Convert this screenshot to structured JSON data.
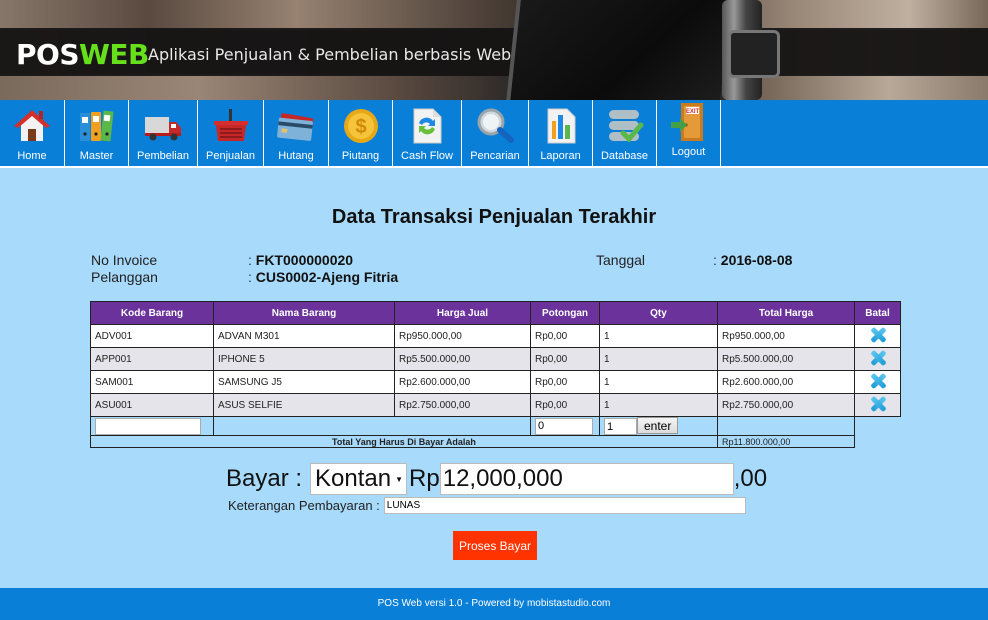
{
  "header": {
    "logo_pos": "POS",
    "logo_web": "WEB",
    "tagline": "Aplikasi Penjualan & Pembelian berbasis Web"
  },
  "nav": {
    "items": [
      {
        "label": "Home",
        "icon": "home-icon"
      },
      {
        "label": "Master",
        "icon": "binders-icon"
      },
      {
        "label": "Pembelian",
        "icon": "truck-icon"
      },
      {
        "label": "Penjualan",
        "icon": "basket-icon"
      },
      {
        "label": "Hutang",
        "icon": "credit-card-icon"
      },
      {
        "label": "Piutang",
        "icon": "coin-icon"
      },
      {
        "label": "Cash Flow",
        "icon": "exchange-document-icon"
      },
      {
        "label": "Pencarian",
        "icon": "magnifier-icon"
      },
      {
        "label": "Laporan",
        "icon": "report-chart-icon"
      },
      {
        "label": "Database",
        "icon": "database-check-icon"
      },
      {
        "label": "Logout",
        "icon": "exit-door-icon"
      }
    ]
  },
  "page": {
    "title": "Data Transaksi Penjualan Terakhir",
    "invoice_label": "No Invoice",
    "invoice_value": "FKT000000020",
    "customer_label": "Pelanggan",
    "customer_value": "CUS0002-Ajeng Fitria",
    "date_label": "Tanggal",
    "date_value": "2016-08-08",
    "colon": ":"
  },
  "table": {
    "headers": [
      "Kode Barang",
      "Nama Barang",
      "Harga Jual",
      "Potongan",
      "Qty",
      "Total Harga",
      "Batal"
    ],
    "rows": [
      {
        "kode": "ADV001",
        "nama": "ADVAN M301",
        "harga": "Rp950.000,00",
        "potongan": "Rp0,00",
        "qty": "1",
        "total": "Rp950.000,00"
      },
      {
        "kode": "APP001",
        "nama": "IPHONE 5",
        "harga": "Rp5.500.000,00",
        "potongan": "Rp0,00",
        "qty": "1",
        "total": "Rp5.500.000,00"
      },
      {
        "kode": "SAM001",
        "nama": "SAMSUNG J5",
        "harga": "Rp2.600.000,00",
        "potongan": "Rp0,00",
        "qty": "1",
        "total": "Rp2.600.000,00"
      },
      {
        "kode": "ASU001",
        "nama": "ASUS SELFIE",
        "harga": "Rp2.750.000,00",
        "potongan": "Rp0,00",
        "qty": "1",
        "total": "Rp2.750.000,00"
      }
    ],
    "entry": {
      "kode_value": "",
      "potongan_value": "0",
      "qty_value": "1",
      "enter_label": "enter"
    },
    "total_label": "Total Yang Harus Di Bayar Adalah",
    "total_value": "Rp11.800.000,00"
  },
  "payment": {
    "bayar_label": "Bayar :",
    "method": "Kontan",
    "currency": "Rp",
    "amount": "12,000,000",
    "decimals": ",00",
    "note_label": "Keterangan Pembayaran :",
    "note_value": "LUNAS",
    "submit_label": "Proses Bayar"
  },
  "footer": {
    "text": "POS Web versi 1.0 - Powered by mobistastudio.com"
  }
}
